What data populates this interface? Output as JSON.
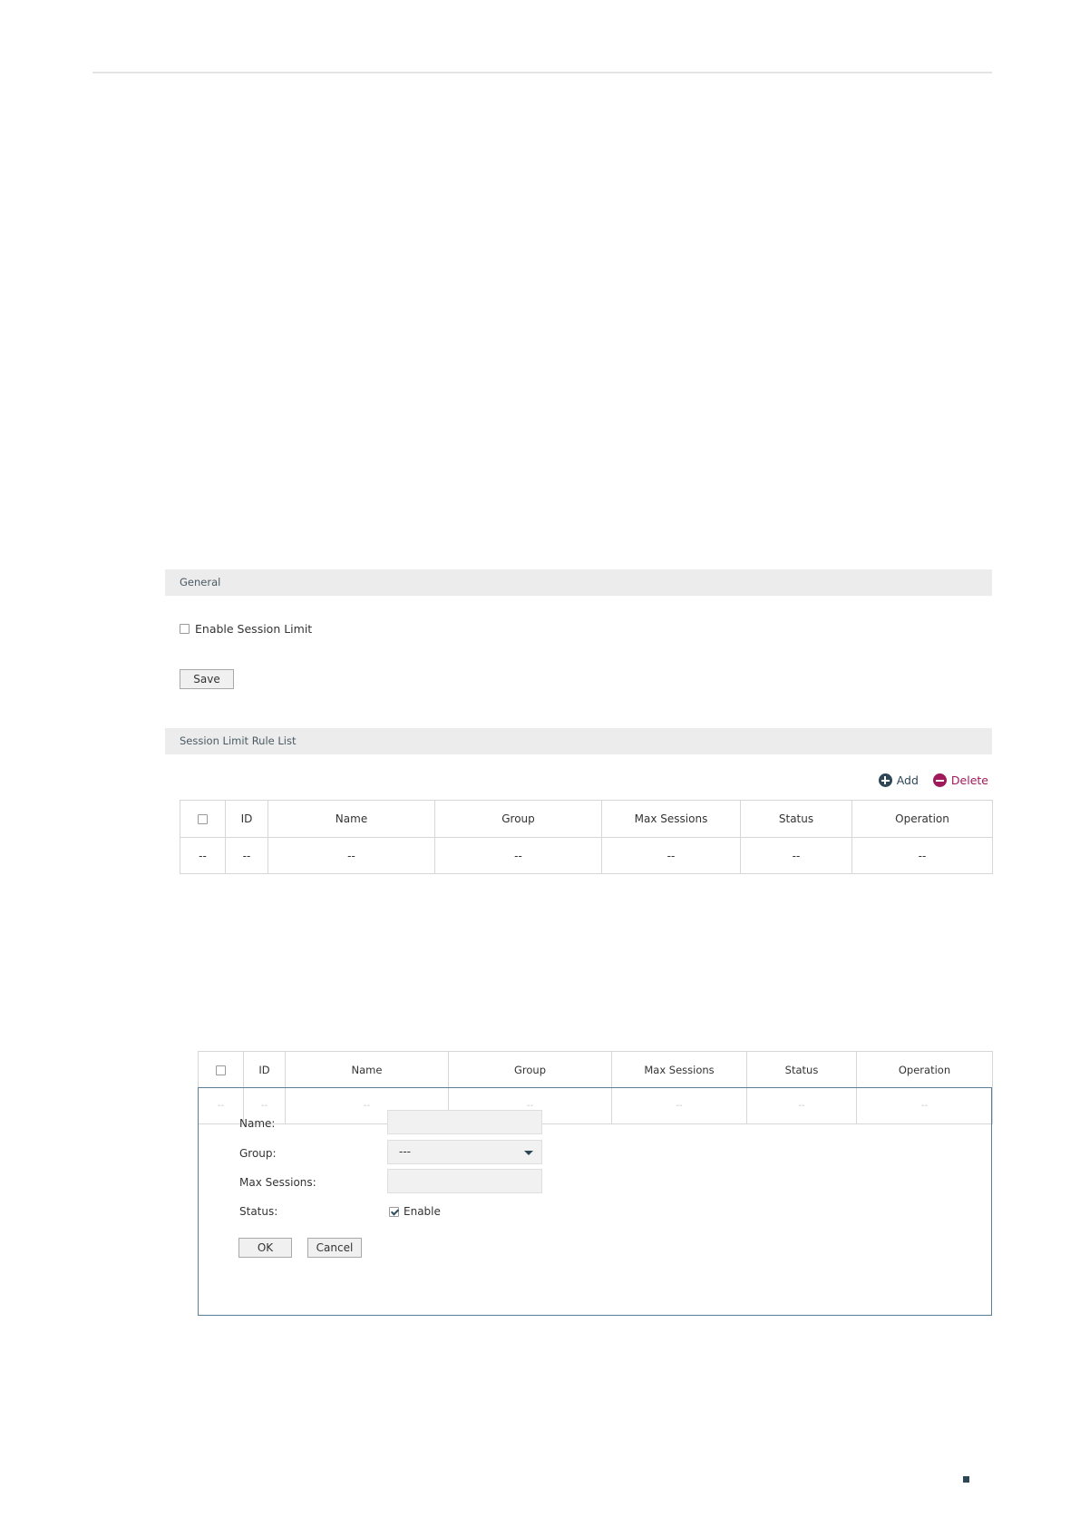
{
  "general": {
    "title": "General",
    "enable_label": "Enable Session Limit",
    "enable_checked": false,
    "save_label": "Save"
  },
  "rule_list": {
    "title": "Session Limit Rule List",
    "add_label": "Add",
    "delete_label": "Delete",
    "columns": [
      "ID",
      "Name",
      "Group",
      "Max Sessions",
      "Status",
      "Operation"
    ],
    "row": [
      "--",
      "--",
      "--",
      "--",
      "--",
      "--",
      "--"
    ]
  },
  "edit_panel": {
    "columns": [
      "ID",
      "Name",
      "Group",
      "Max Sessions",
      "Status",
      "Operation"
    ],
    "row": [
      "--",
      "--",
      "--",
      "--",
      "--",
      "--",
      "--"
    ],
    "name_label": "Name:",
    "name_value": "",
    "group_label": "Group:",
    "group_value": "---",
    "max_sessions_label": "Max Sessions:",
    "max_sessions_value": "",
    "status_label": "Status:",
    "status_enable_label": "Enable",
    "status_checked": true,
    "ok_label": "OK",
    "cancel_label": "Cancel"
  },
  "colors": {
    "accent": "#2d4756",
    "delete": "#a0195a",
    "bar": "#ececec",
    "panel_border": "#5a7e98"
  }
}
